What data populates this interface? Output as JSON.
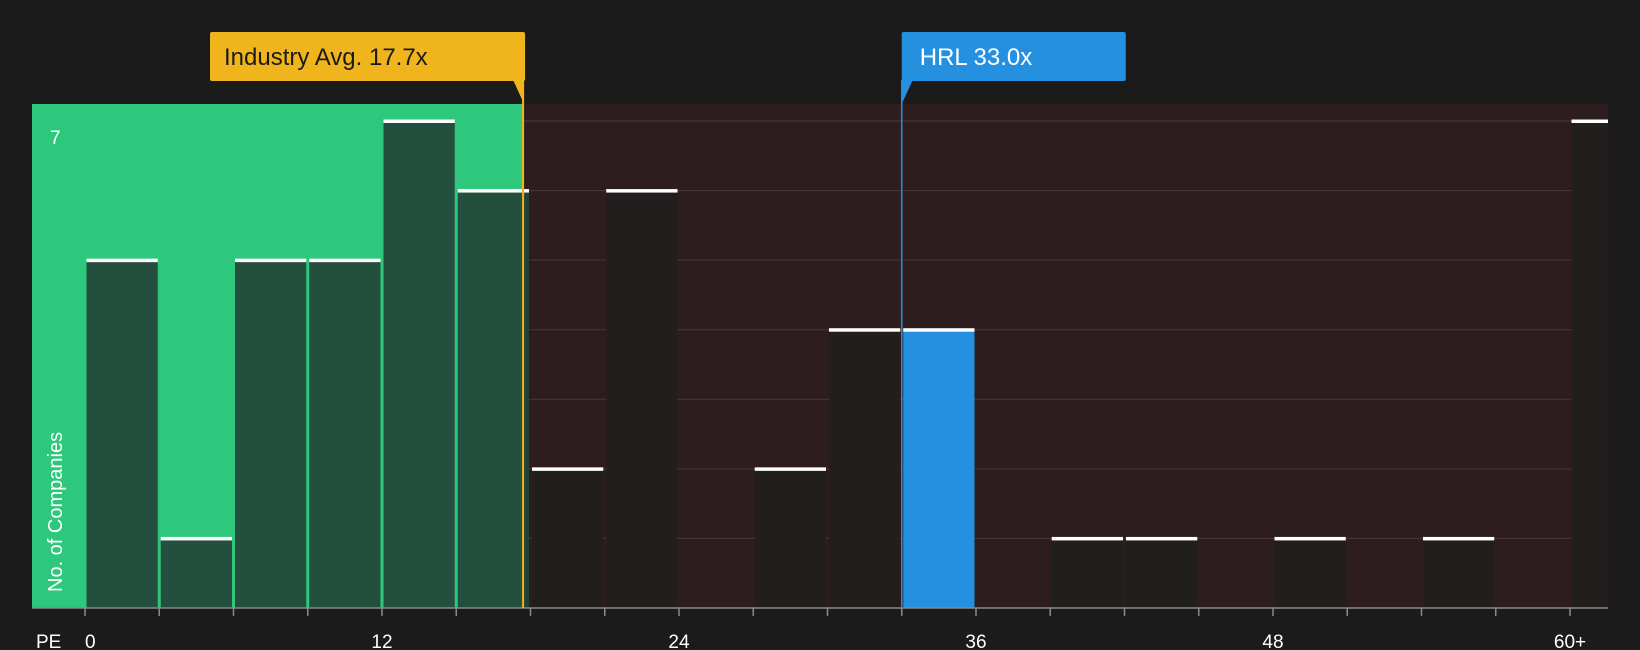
{
  "chart_data": {
    "type": "bar",
    "x_axis_label": "PE",
    "y_axis_title": "No. of Companies",
    "y_max_label": "7",
    "x_range": [
      0,
      62
    ],
    "y_range": [
      0,
      7.25
    ],
    "x_tick_labels": [
      {
        "value": 0,
        "label": "0"
      },
      {
        "value": 12,
        "label": "12"
      },
      {
        "value": 24,
        "label": "24"
      },
      {
        "value": 36,
        "label": "36"
      },
      {
        "value": 48,
        "label": "48"
      },
      {
        "value": 60,
        "label": "60+"
      }
    ],
    "bin_width": 3,
    "bins": [
      {
        "start": 0,
        "count": 5
      },
      {
        "start": 3,
        "count": 1
      },
      {
        "start": 6,
        "count": 5
      },
      {
        "start": 9,
        "count": 5
      },
      {
        "start": 12,
        "count": 7
      },
      {
        "start": 15,
        "count": 6
      },
      {
        "start": 18,
        "count": 2
      },
      {
        "start": 21,
        "count": 6
      },
      {
        "start": 24,
        "count": 0
      },
      {
        "start": 27,
        "count": 2
      },
      {
        "start": 30,
        "count": 4
      },
      {
        "start": 33,
        "count": 4,
        "highlight": true
      },
      {
        "start": 36,
        "count": 0
      },
      {
        "start": 39,
        "count": 1
      },
      {
        "start": 42,
        "count": 1
      },
      {
        "start": 45,
        "count": 0
      },
      {
        "start": 48,
        "count": 1
      },
      {
        "start": 51,
        "count": 0
      },
      {
        "start": 54,
        "count": 1
      },
      {
        "start": 57,
        "count": 0
      },
      {
        "start": 60,
        "count": 7
      }
    ],
    "industry_average": {
      "label": "Industry Avg. 17.7x",
      "value": 17.7
    },
    "company": {
      "label": "HRL 33.0x",
      "value": 33.0
    },
    "colors": {
      "background": "#1b1b1b",
      "undervalued_region": "#2ec87c",
      "overvalued_region": "#2d1d1f",
      "industry_marker": "#f0b41c",
      "company_marker": "#2590e0",
      "bar_in_green": "#24443a",
      "bar_in_dark": "#221e1e",
      "bar_top": "#ffffff"
    }
  }
}
